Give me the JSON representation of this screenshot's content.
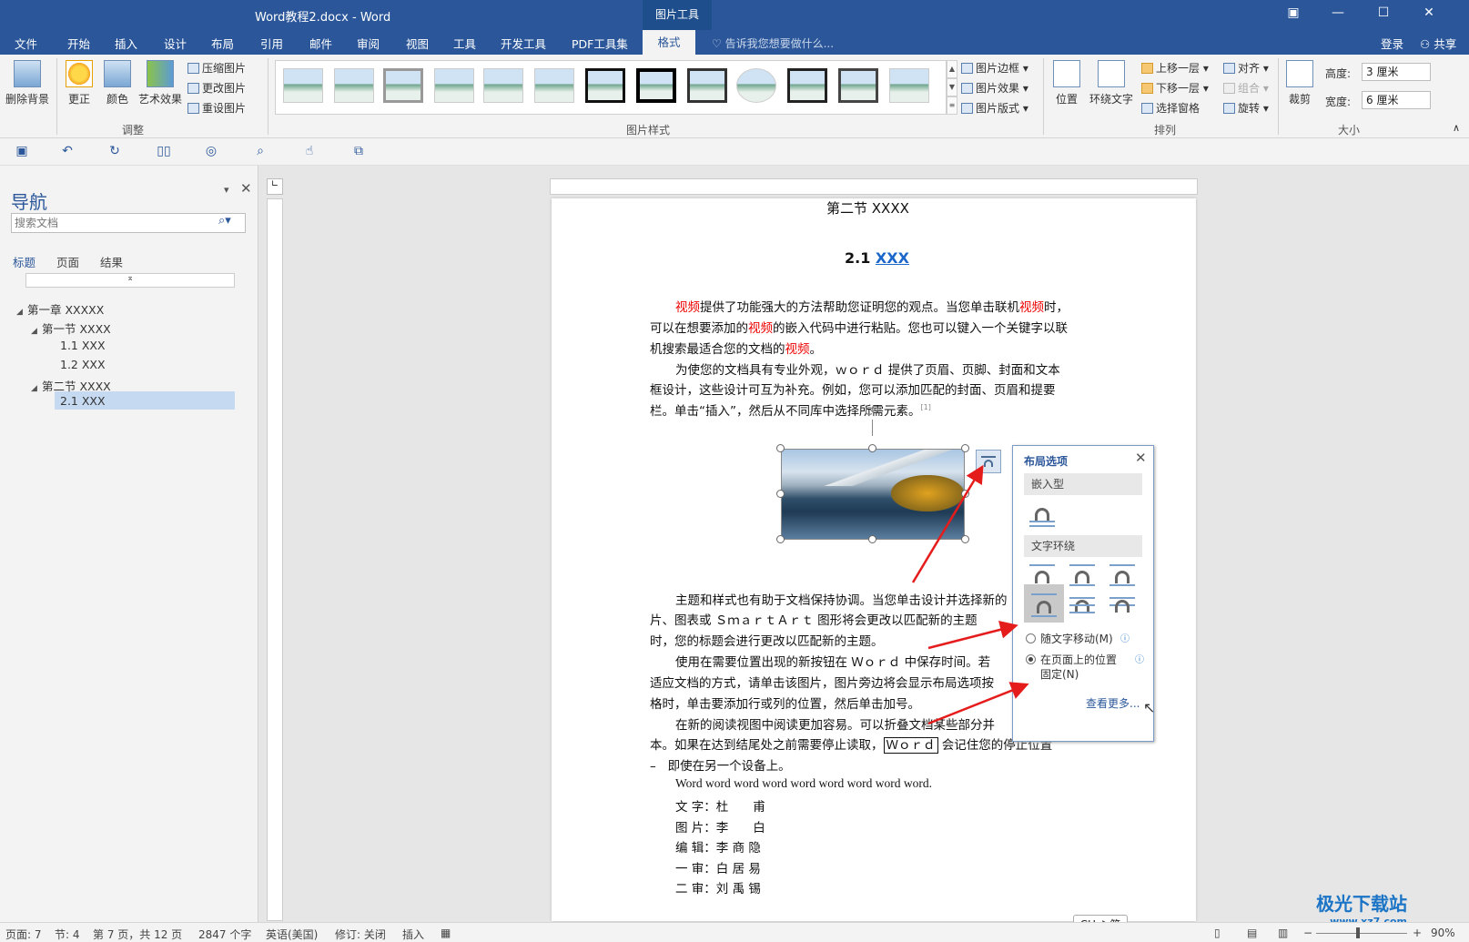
{
  "titlebar": {
    "title": "Word教程2.docx - Word",
    "context_group": "图片工具"
  },
  "tabs": [
    "文件",
    "开始",
    "插入",
    "设计",
    "布局",
    "引用",
    "邮件",
    "审阅",
    "视图",
    "工具",
    "开发工具",
    "PDF工具集"
  ],
  "active_tab": "格式",
  "tellme": "告诉我您想要做什么...",
  "account": {
    "login": "登录",
    "share": "共享"
  },
  "ribbon": {
    "remove_bg": "删除背景",
    "corrections": "更正",
    "color": "颜色",
    "artistic": "艺术效果",
    "compress": "压缩图片",
    "change": "更改图片",
    "reset": "重设图片",
    "adjust_group": "调整",
    "styles_group": "图片样式",
    "border": "图片边框",
    "effects": "图片效果",
    "layout": "图片版式",
    "position": "位置",
    "wrap": "环绕文字",
    "forward": "上移一层",
    "backward": "下移一层",
    "selection_pane": "选择窗格",
    "align": "对齐",
    "group": "组合",
    "rotate": "旋转",
    "arrange_group": "排列",
    "crop": "裁剪",
    "height_label": "高度:",
    "height_value": "3 厘米",
    "width_label": "宽度:",
    "width_value": "6 厘米",
    "size_group": "大小"
  },
  "nav": {
    "title": "导航",
    "search_placeholder": "搜索文档",
    "tabs": [
      "标题",
      "页面",
      "结果"
    ],
    "tree": [
      "第一章 XXXXX",
      "第一节 XXXX",
      "1.1 XXX",
      "1.2 XXX",
      "第二节 XXXX",
      "2.1 XXX"
    ]
  },
  "document": {
    "section_heading": "第二节  XXXX",
    "heading_num": "2.1 ",
    "heading_link": "XXX",
    "p1_l1_a": "视频",
    "p1_l1_b": "提供了功能强大的方法帮助您证明您的观点。当您单击联机",
    "p1_l1_c": "视频",
    "p1_l1_d": "时，",
    "p1_l2_a": "可以在想要添加的",
    "p1_l2_b": "视频",
    "p1_l2_c": "的嵌入代码中进行粘贴。您也可以键入一个关键字以联",
    "p1_l3_a": "机搜索最适合您的文档的",
    "p1_l3_b": "视频",
    "p1_l3_c": "。",
    "p2_l1": "为使您的文档具有专业外观，ｗｏｒｄ  提供了页眉、页脚、封面和文本",
    "p2_l2": "框设计，这些设计可互为补充。例如，您可以添加匹配的封面、页眉和提要",
    "p2_l3": "栏。单击“插入”，然后从不同库中选择所需元素。",
    "p2_note": "[1]",
    "p3_l1": "主题和样式也有助于文档保持协调。当您单击设计并选择新的",
    "p3_l2": "片、图表或  ＳｍａｒｔＡｒｔ  图形将会更改以匹配新的主题",
    "p3_l3": "时，您的标题会进行更改以匹配新的主题。",
    "p4_l1": "使用在需要位置出现的新按钮在  Ｗｏｒｄ  中保存时间。若",
    "p4_l2": "适应文档的方式，请单击该图片，图片旁边将会显示布局选项按",
    "p4_l3": "格时，单击要添加行或列的位置，然后单击加号。",
    "p5_l1": "在新的阅读视图中阅读更加容易。可以折叠文档某些部分并",
    "p5_l2_a": "本。如果在达到结尾处之前需要停止读取，",
    "p5_l2_b": "Ｗｏｒｄ",
    "p5_l2_c": " 会记住您的停止位置",
    "p5_l3_dash": "–",
    "p5_l3": "即使在另一个设备上。",
    "p6": "Word word word word word word word word word.",
    "credits": [
      "文 字：杜　　甫",
      "图 片：李　　白",
      "编 辑：李 商 隐",
      "一 审：白 居 易",
      "二 审：刘 禹 锡"
    ]
  },
  "layout_popup": {
    "title": "布局选项",
    "inline_header": "嵌入型",
    "wrap_header": "文字环绕",
    "move_with_text": "随文字移动(M)",
    "fix_position_l1": "在页面上的位置",
    "fix_position_l2": "固定(N)",
    "see_more": "查看更多..."
  },
  "status": {
    "page": "页面: 7",
    "section": "节: 4",
    "page_of": "第 7 页，共 12 页",
    "words": "2847 个字",
    "language": "英语(美国)",
    "track": "修订: 关闭",
    "insert": "插入",
    "zoom": "90%"
  },
  "ime": "CH ♪ 简",
  "watermark": "极光下载站",
  "watermark_url": "www.xz7.com"
}
